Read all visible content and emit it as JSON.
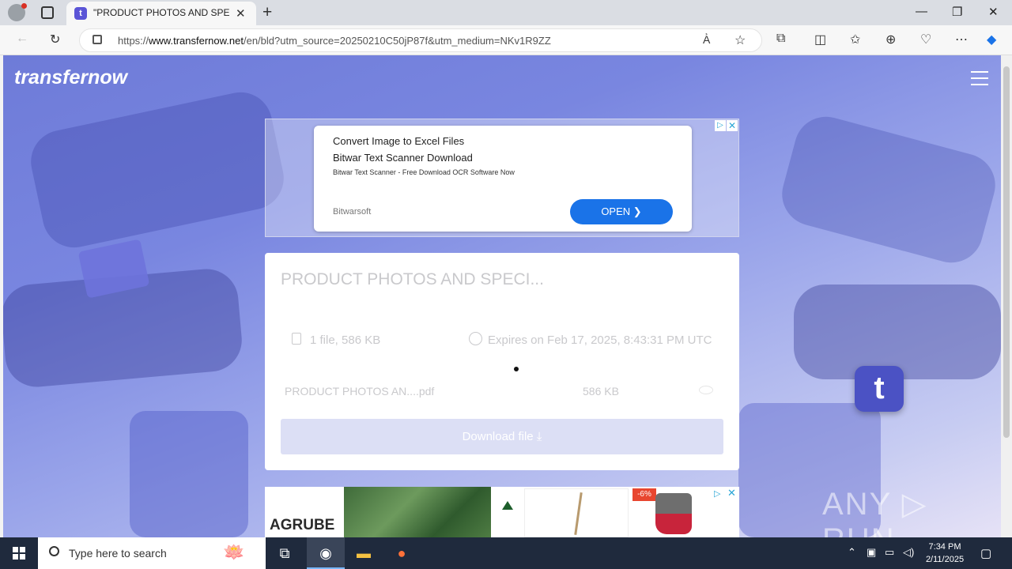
{
  "browser": {
    "tab_title": "\"PRODUCT PHOTOS AND SPECIFI",
    "tab_favicon": "t",
    "url_prefix": "https://",
    "url_domain": "www.transfernow.net",
    "url_path": "/en/bld?utm_source=20250210C50jP87f&utm_medium=NKv1R9ZZ"
  },
  "site": {
    "logo": "transfernow",
    "badge_letter": "t"
  },
  "ad_top": {
    "title": "Convert Image to Excel Files",
    "subtitle": "Bitwar Text Scanner Download",
    "description": "Bitwar Text Scanner - Free Download OCR Software Now",
    "brand": "Bitwarsoft",
    "button": "OPEN ❯",
    "adchoices": "▷",
    "close": "✕"
  },
  "transfer": {
    "title": "PRODUCT PHOTOS AND SPECI...",
    "file_count": "1 file, 586 KB",
    "expires": "Expires on Feb 17, 2025, 8:43:31 PM UTC",
    "file_name": "PRODUCT PHOTOS AN....pdf",
    "file_size": "586 KB",
    "download_label": "Download file  ⤓"
  },
  "ad_bottom": {
    "logo": "AGRUBE",
    "discount": "-6%",
    "adchoices": "▷",
    "close": "✕"
  },
  "watermark": "ANY ▷ RUN",
  "taskbar": {
    "search_placeholder": "Type here to search",
    "time": "7:34 PM",
    "date": "2/11/2025"
  }
}
